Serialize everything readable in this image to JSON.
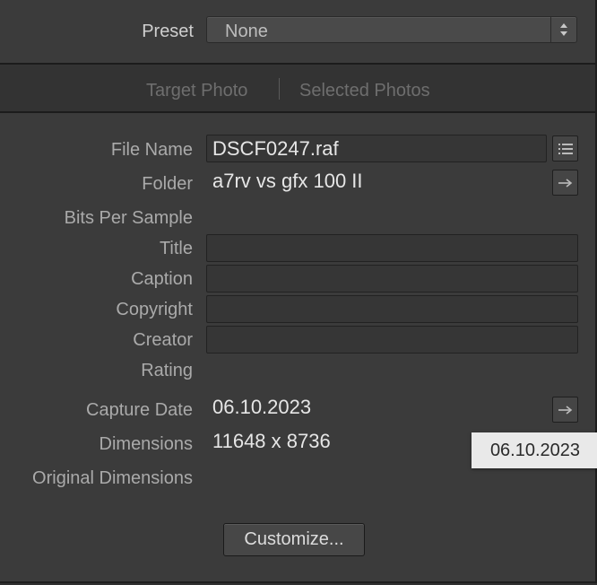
{
  "preset": {
    "label": "Preset",
    "value": "None"
  },
  "tabs": [
    {
      "label": "Target Photo"
    },
    {
      "label": "Selected Photos"
    }
  ],
  "fields": {
    "file_name": {
      "label": "File Name",
      "value": "DSCF0247.raf"
    },
    "folder": {
      "label": "Folder",
      "value": "a7rv vs gfx 100 II"
    },
    "bits_per_sample": {
      "label": "Bits Per Sample",
      "value": ""
    },
    "title": {
      "label": "Title",
      "value": ""
    },
    "caption": {
      "label": "Caption",
      "value": ""
    },
    "copyright": {
      "label": "Copyright",
      "value": ""
    },
    "creator": {
      "label": "Creator",
      "value": ""
    },
    "rating": {
      "label": "Rating",
      "value": ""
    },
    "capture_date": {
      "label": "Capture Date",
      "value": "06.10.2023"
    },
    "dimensions": {
      "label": "Dimensions",
      "value": "11648 x 8736"
    },
    "original_dimensions": {
      "label": "Original Dimensions",
      "value": ""
    }
  },
  "tooltip": {
    "text": "06.10.2023"
  },
  "customize": {
    "label": "Customize..."
  },
  "icons": {
    "file_name_action": "list-icon",
    "folder_action": "go-to-arrow-icon",
    "capture_date_action": "go-to-arrow-icon",
    "preset_stepper": "up-down-chevron-icon"
  },
  "colors": {
    "panel_background": "#3b3b3b",
    "tooltip_background": "#e9e9e9"
  }
}
